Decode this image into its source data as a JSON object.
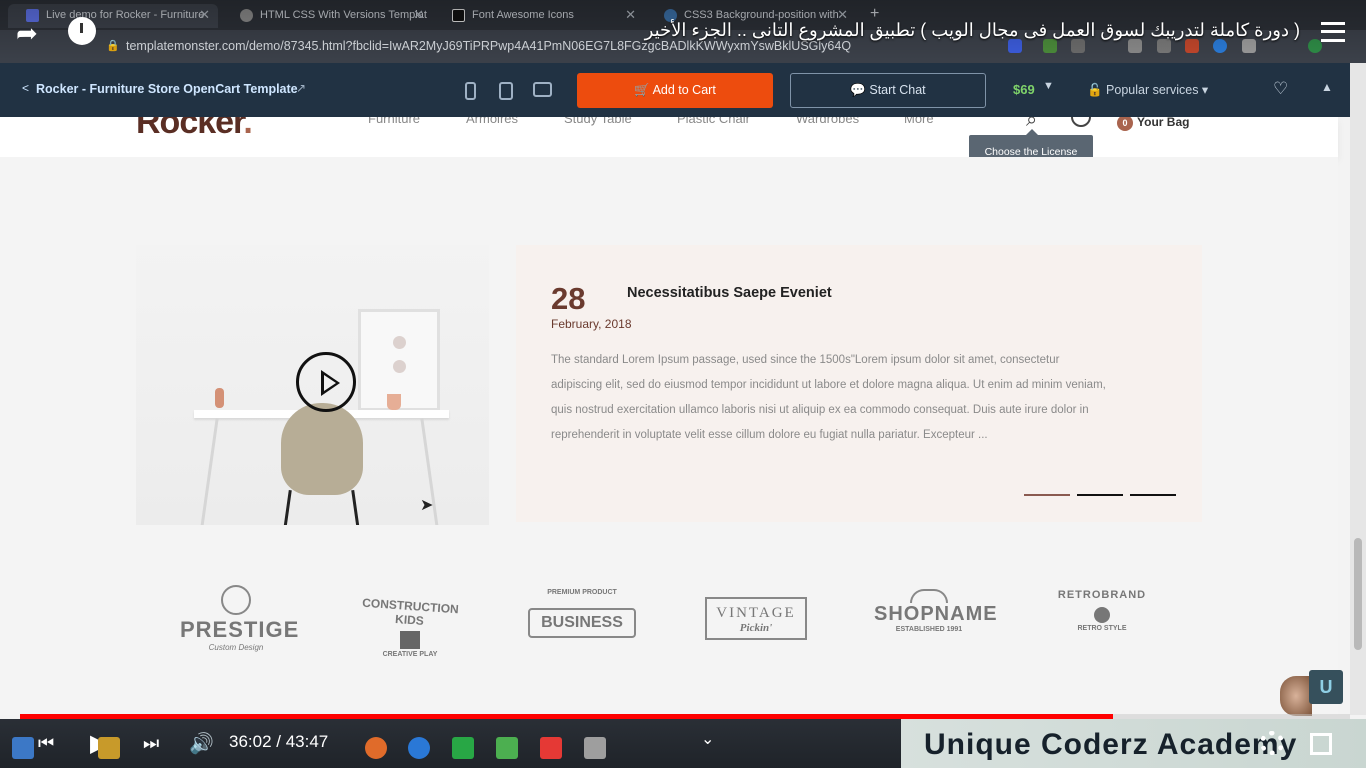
{
  "browser": {
    "tabs": [
      {
        "label": "Live demo for Rocker - Furniture",
        "color": "#5b6ee1"
      },
      {
        "label": "HTML CSS With Versions Templat",
        "color": "#888888"
      },
      {
        "label": "Font Awesome Icons",
        "color": "#222222"
      },
      {
        "label": "CSS3 Background-position with",
        "color": "#3a6ea5"
      }
    ],
    "url": "templatemonster.com/demo/87345.html?fbclid=IwAR2MyJ69TiPRPwp4A41PmN06EG7L8FGzgcBADlkKWWyxmYswBklUSGly64Q"
  },
  "video": {
    "title": "( دورة كاملة لتدريبك لسوق العمل فى مجال الويب ) تطبيق المشروع التانى .. الجزء الأخير",
    "time_current": "36:02",
    "time_total": "43:47",
    "time_display": "36:02 / 43:47",
    "progress_fraction": 0.822,
    "watermark": "Unique Coderz Academy",
    "badge": "U"
  },
  "tm_bar": {
    "back_glyph": "<",
    "template_name": "Rocker - Furniture Store OpenCart Template",
    "add_to_cart": "Add to Cart",
    "start_chat": "Start Chat",
    "price": "$69",
    "popular_services": "Popular services",
    "accent": "#ed4c0e"
  },
  "site": {
    "logo_main": "Rocker",
    "logo_dot": ".",
    "nav": [
      "Furniture",
      "Armoires",
      "Study Table",
      "Plastic Chair",
      "Wardrobes",
      "More"
    ],
    "bag_label": "Your Bag",
    "bag_count": "0",
    "tooltip": "Choose the License"
  },
  "blog": {
    "day": "28",
    "month": "February, 2018",
    "title": "Necessitatibus Saepe Eveniet",
    "body": "The standard Lorem Ipsum passage, used since the 1500s\"Lorem ipsum dolor sit amet, consectetur adipiscing elit, sed do eiusmod tempor incididunt ut labore et dolore magna aliqua. Ut enim ad minim veniam, quis nostrud exercitation ullamco laboris nisi ut aliquip ex ea commodo consequat. Duis aute irure dolor in reprehenderit in voluptate velit esse cillum dolore eu fugiat nulla pariatur. Excepteur ...",
    "dots": 3,
    "active_dot": 0
  },
  "brands": [
    {
      "name": "PRESTIGE",
      "sub": "Custom Design"
    },
    {
      "name": "CONSTRUCTION KIDS",
      "sub": "CREATIVE PLAY"
    },
    {
      "name": "BUSINESS",
      "sub": "PREMIUM PRODUCT"
    },
    {
      "name": "VINTAGE",
      "sub": "Pickin'"
    },
    {
      "name": "SHOPNAME",
      "sub": "ESTABLISHED 1991"
    },
    {
      "name": "RETROBRAND",
      "sub": "RETRO STYLE"
    }
  ]
}
